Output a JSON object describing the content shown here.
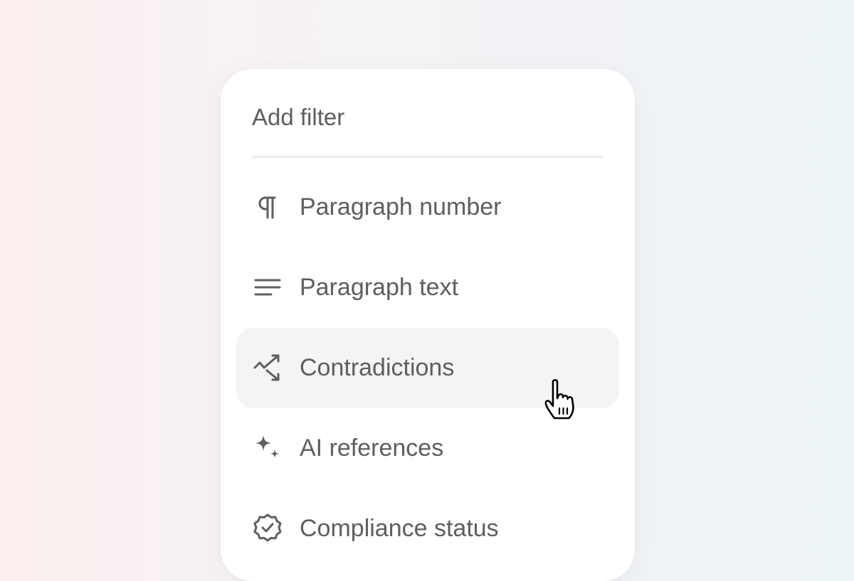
{
  "filter_menu": {
    "title": "Add filter",
    "items": [
      {
        "label": "Paragraph number",
        "icon": "pilcrow-icon"
      },
      {
        "label": "Paragraph text",
        "icon": "text-lines-icon"
      },
      {
        "label": "Contradictions",
        "icon": "trend-arrows-icon",
        "hovered": true
      },
      {
        "label": "AI references",
        "icon": "sparkles-icon"
      },
      {
        "label": "Compliance status",
        "icon": "badge-check-icon"
      }
    ]
  },
  "colors": {
    "text": "#5e5e62",
    "hover_background": "#f4f4f5",
    "divider": "#ebebed"
  }
}
